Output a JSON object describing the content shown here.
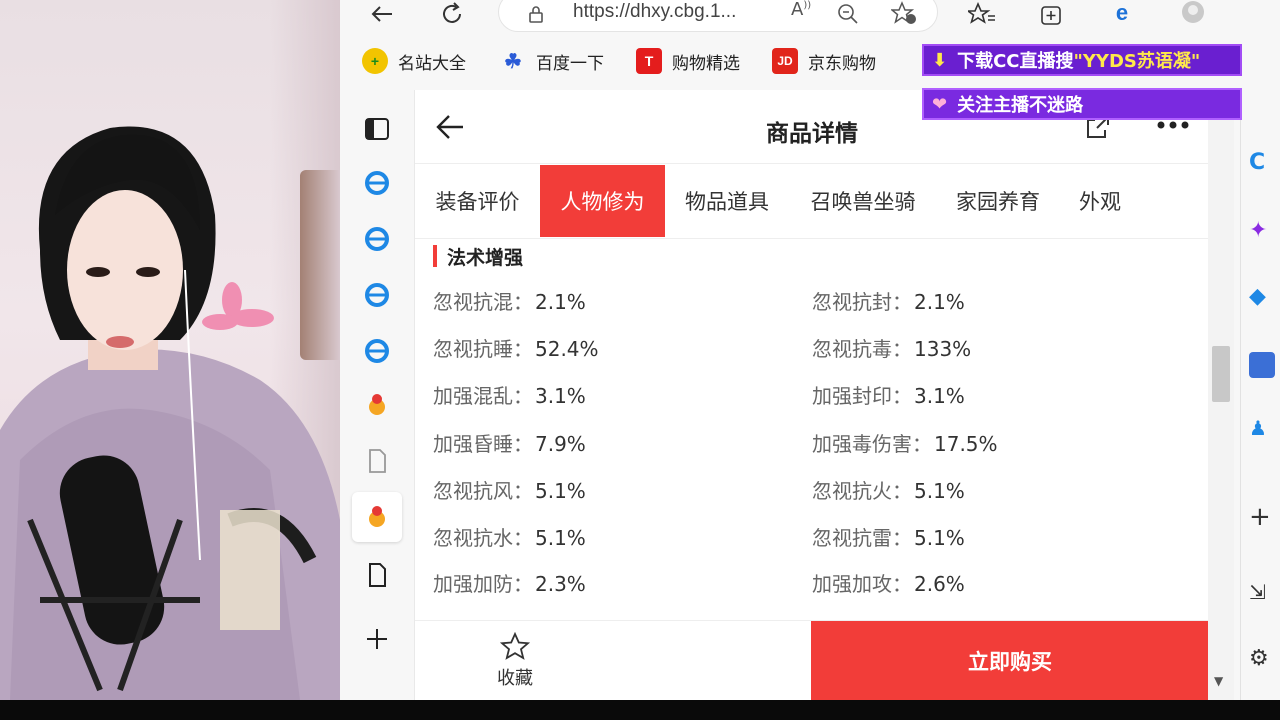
{
  "browser": {
    "url": "https://dhxy.cbg.1...",
    "url_extra": "A⁰",
    "favorites": [
      {
        "label": "名站大全",
        "icon": "plus-circle-icon",
        "color": "#f2c400"
      },
      {
        "label": "百度一下",
        "icon": "paw-icon",
        "color": "#2a5bd7"
      },
      {
        "label": "购物精选",
        "icon": "T-icon",
        "color": "#e41d1d"
      },
      {
        "label": "京东购物",
        "icon": "JD-icon",
        "color": "#e1251b"
      }
    ]
  },
  "page": {
    "title": "商品详情",
    "tabs": [
      {
        "label": "装备评价",
        "active": false
      },
      {
        "label": "人物修为",
        "active": true
      },
      {
        "label": "物品道具",
        "active": false
      },
      {
        "label": "召唤兽坐骑",
        "active": false
      },
      {
        "label": "家园养育",
        "active": false
      },
      {
        "label": "外观",
        "active": false
      }
    ],
    "section_title": "法术增强",
    "stats": [
      {
        "label": "忽视抗混：",
        "value": "2.1%"
      },
      {
        "label": "忽视抗封：",
        "value": "2.1%"
      },
      {
        "label": "忽视抗睡：",
        "value": "52.4%"
      },
      {
        "label": "忽视抗毒：",
        "value": "133%"
      },
      {
        "label": "加强混乱：",
        "value": "3.1%"
      },
      {
        "label": "加强封印：",
        "value": "3.1%"
      },
      {
        "label": "加强昏睡：",
        "value": "7.9%"
      },
      {
        "label": "加强毒伤害：",
        "value": "17.5%"
      },
      {
        "label": "忽视抗风：",
        "value": "5.1%"
      },
      {
        "label": "忽视抗火：",
        "value": "5.1%"
      },
      {
        "label": "忽视抗水：",
        "value": "5.1%"
      },
      {
        "label": "忽视抗雷：",
        "value": "5.1%"
      },
      {
        "label": "加强加防：",
        "value": "2.3%"
      },
      {
        "label": "加强加攻：",
        "value": "2.6%"
      }
    ],
    "favorite_label": "收藏",
    "buy_label": "立即购买"
  },
  "overlay": {
    "line1_prefix": "下载CC直播搜",
    "line1_highlight": "\"YYDS苏语凝\"",
    "line2": "关注主播不迷路"
  },
  "colors": {
    "accent": "#f23d39",
    "overlay_purple": "#6a1fd0"
  }
}
